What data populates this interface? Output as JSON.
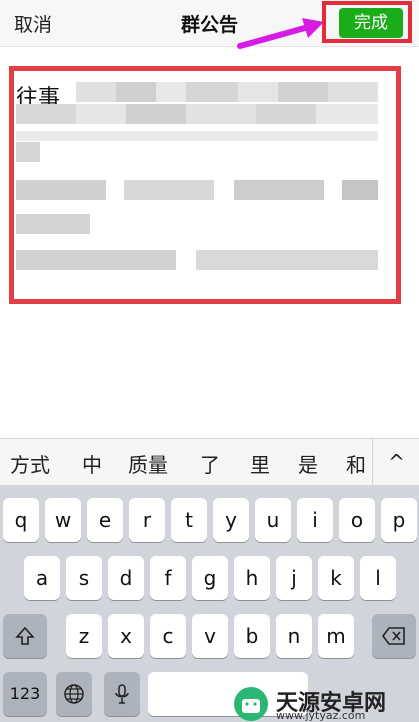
{
  "nav": {
    "cancel": "取消",
    "title": "群公告",
    "done": "完成"
  },
  "editor": {
    "text": "往事"
  },
  "candidates": [
    "方式",
    "中",
    "质量",
    "了",
    "里",
    "是",
    "和"
  ],
  "candidates_more_icon": "chevron-up-icon",
  "keyboard": {
    "row1": [
      "q",
      "w",
      "e",
      "r",
      "t",
      "y",
      "u",
      "i",
      "o",
      "p"
    ],
    "row2": [
      "a",
      "s",
      "d",
      "f",
      "g",
      "h",
      "j",
      "k",
      "l"
    ],
    "row3": [
      "z",
      "x",
      "c",
      "v",
      "b",
      "n",
      "m"
    ],
    "numbers": "123"
  },
  "watermark": {
    "title": "天源安卓网",
    "url": "www.jytyaz.com"
  },
  "colors": {
    "done_green": "#1aad19",
    "highlight_red": "#e32d3a",
    "arrow_magenta": "#d61be5",
    "keyboard_bg": "#d1d4da"
  }
}
